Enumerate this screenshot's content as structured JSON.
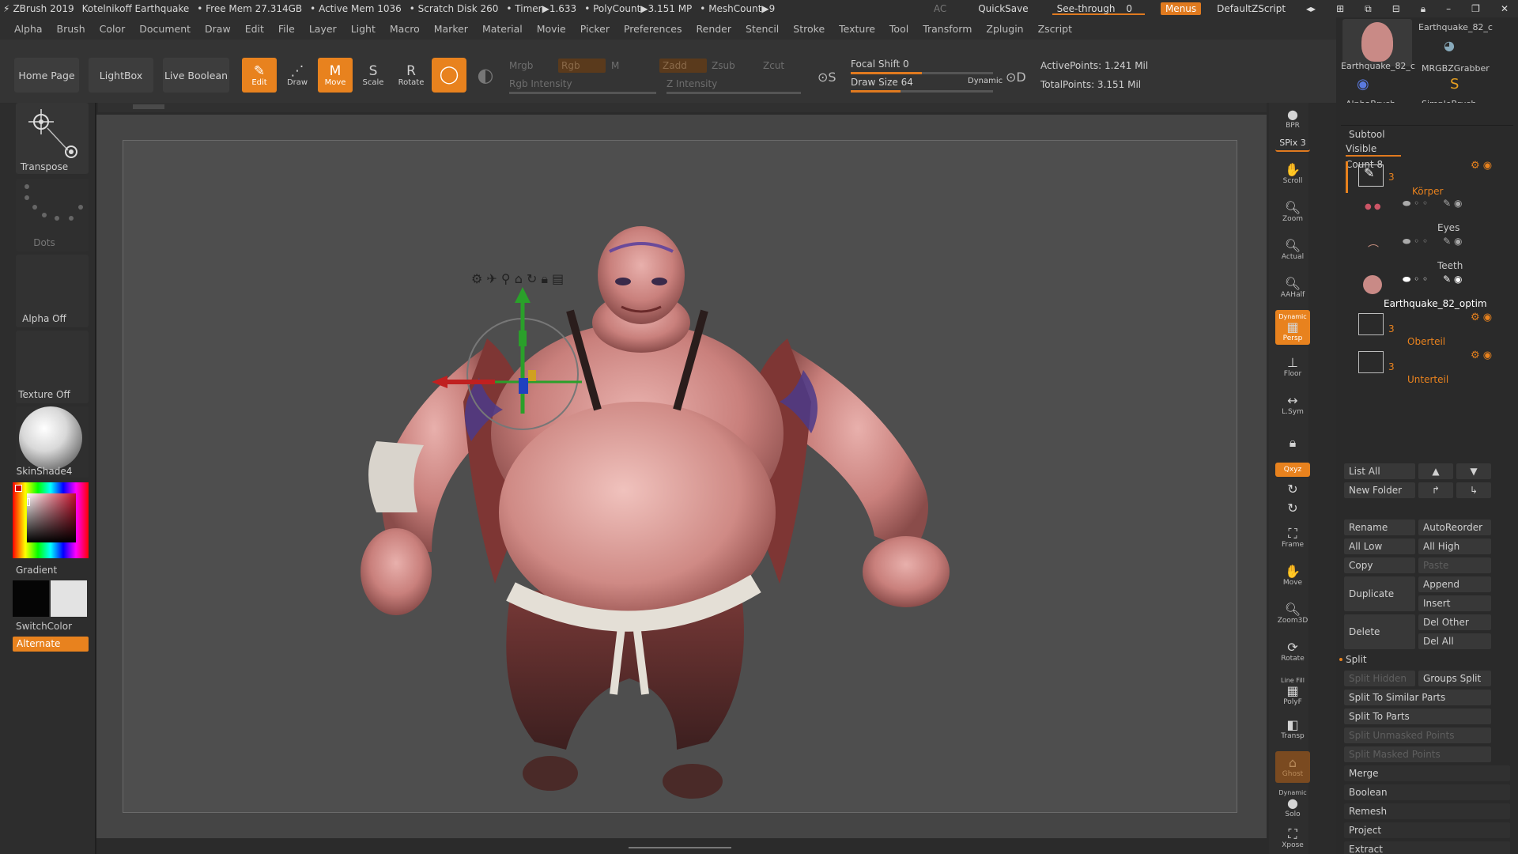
{
  "titlebar": {
    "app": "ZBrush 2019",
    "document": "Kotelnikoff Earthquake",
    "free_mem": "• Free Mem 27.314GB",
    "active_mem": "• Active Mem 1036",
    "scratch": "• Scratch Disk 260",
    "timer": "• Timer▶1.633",
    "polycount": "• PolyCount▶3.151 MP",
    "meshcount": "• MeshCount▶9",
    "ac": "AC",
    "quicksave": "QuickSave",
    "see_through": "See-through",
    "see_through_value": "0",
    "menus": "Menus",
    "script": "DefaultZScript"
  },
  "menubar": [
    "Alpha",
    "Brush",
    "Color",
    "Document",
    "Draw",
    "Edit",
    "File",
    "Layer",
    "Light",
    "Macro",
    "Marker",
    "Material",
    "Movie",
    "Picker",
    "Preferences",
    "Render",
    "Stencil",
    "Stroke",
    "Texture",
    "Tool",
    "Transform",
    "Zplugin",
    "Zscript"
  ],
  "shelf": {
    "home": "Home Page",
    "lightbox": "LightBox",
    "live_boolean": "Live Boolean",
    "edit": "Edit",
    "draw": "Draw",
    "move": "Move",
    "scale": "Scale",
    "rotate": "Rotate",
    "mrgb": "Mrgb",
    "rgb": "Rgb",
    "m": "M",
    "zadd": "Zadd",
    "zsub": "Zsub",
    "zcut": "Zcut",
    "rgb_intensity": "Rgb Intensity",
    "z_intensity": "Z Intensity",
    "focal_shift": "Focal Shift 0",
    "draw_size": "Draw Size 64",
    "dynamic": "Dynamic",
    "active_points": "ActivePoints: 1.241 Mil",
    "total_points": "TotalPoints: 3.151 Mil",
    "focal_shift_level": 0.5,
    "draw_size_level": 0.35
  },
  "left": {
    "transpose": "Transpose",
    "dots": "Dots",
    "alpha": "Alpha Off",
    "texture": "Texture Off",
    "material": "SkinShade4",
    "gradient": "Gradient",
    "switch_color": "SwitchColor",
    "alternate": "Alternate"
  },
  "rstrip": {
    "bpr": "BPR",
    "spix": "SPix 3",
    "scroll": "Scroll",
    "zoom": "Zoom",
    "actual": "Actual",
    "aahalf": "AAHalf",
    "dynamic": "Dynamic",
    "persp": "Persp",
    "floor": "Floor",
    "lsym": "L.Sym",
    "xyz": "Qxyz",
    "frame": "Frame",
    "move": "Move",
    "zoom3d": "Zoom3D",
    "rotate": "Rotate",
    "linefill": "Line Fill",
    "polyf": "PolyF",
    "transp": "Transp",
    "ghost": "Ghost",
    "dynamic2": "Dynamic",
    "solo": "Solo",
    "xpose": "Xpose"
  },
  "brushes": {
    "b1": "Earthquake_82_c",
    "b2": "Earthquake_82_c",
    "b3": "MRGBZGrabber",
    "b4": "AlphaBrush",
    "b5": "SimpleBrush"
  },
  "subtool": {
    "header": "Subtool",
    "visible_count": "Visible Count 8",
    "items": [
      {
        "count": "3",
        "name": "Körper"
      },
      {
        "name": "Eyes"
      },
      {
        "name": "Teeth"
      },
      {
        "name": "Earthquake_82_optim"
      },
      {
        "count": "3",
        "name": "Oberteil"
      },
      {
        "count": "3",
        "name": "Unterteil"
      }
    ],
    "list_all": "List All",
    "new_folder": "New Folder",
    "rename": "Rename",
    "autoreorder": "AutoReorder",
    "all_low": "All Low",
    "all_high": "All High",
    "copy": "Copy",
    "paste": "Paste",
    "duplicate": "Duplicate",
    "append": "Append",
    "insert": "Insert",
    "delete": "Delete",
    "del_other": "Del Other",
    "del_all": "Del All",
    "split": "Split",
    "split_hidden": "Split Hidden",
    "groups_split": "Groups Split",
    "split_similar": "Split To Similar Parts",
    "split_parts": "Split To Parts",
    "split_unmasked": "Split Unmasked Points",
    "split_masked": "Split Masked Points",
    "merge": "Merge",
    "boolean": "Boolean",
    "remesh": "Remesh",
    "project": "Project",
    "extract": "Extract"
  }
}
